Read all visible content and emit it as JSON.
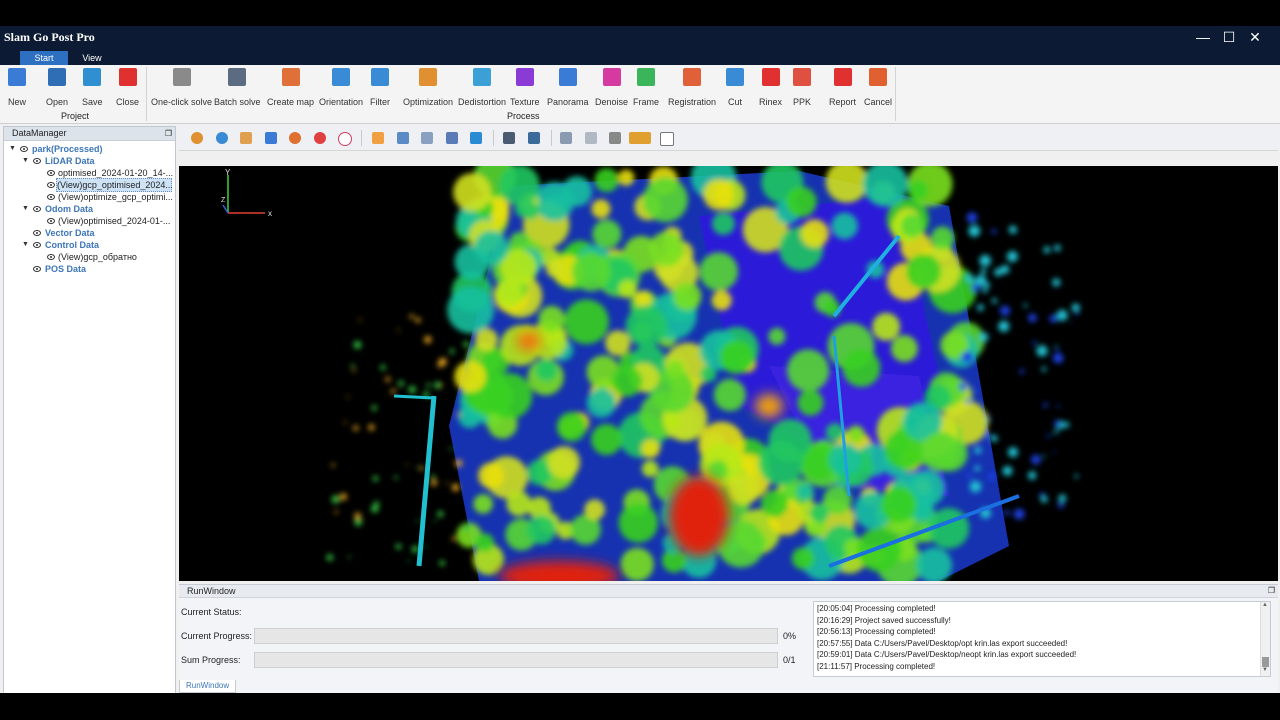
{
  "window": {
    "title": "Slam Go Post Pro",
    "minimize_glyph": "—",
    "maximize_glyph": "☐",
    "close_glyph": "✕"
  },
  "ribbon_tabs": [
    {
      "label": "Start",
      "active": true
    },
    {
      "label": "View",
      "active": false
    }
  ],
  "ribbon": {
    "groups": [
      {
        "label": "Project"
      },
      {
        "label": "Process"
      }
    ],
    "project_buttons": [
      {
        "label": "New",
        "icon": "new-file-icon",
        "color": "#3a7bd5"
      },
      {
        "label": "Open",
        "icon": "open-folder-icon",
        "color": "#2f6db5"
      },
      {
        "label": "Save",
        "icon": "save-disk-icon",
        "color": "#2f8fd0"
      },
      {
        "label": "Close",
        "icon": "close-icon",
        "color": "#e03030"
      }
    ],
    "process_buttons": [
      {
        "label": "One-click solve",
        "icon": "one-click-solve-icon",
        "color": "#8a8a8a"
      },
      {
        "label": "Batch solve",
        "icon": "batch-solve-icon",
        "color": "#5a6b82"
      },
      {
        "label": "Create map",
        "icon": "create-map-icon",
        "color": "#e0703a"
      },
      {
        "label": "Orientation",
        "icon": "orientation-icon",
        "color": "#3a8bd5"
      },
      {
        "label": "Filter",
        "icon": "filter-icon",
        "color": "#3a8bd5"
      },
      {
        "label": "Optimization",
        "icon": "optimization-icon",
        "color": "#e09030"
      },
      {
        "label": "Dedistortion",
        "icon": "dedistortion-icon",
        "color": "#3aa0d5"
      },
      {
        "label": "Texture",
        "icon": "texture-icon",
        "color": "#8a3ad5"
      },
      {
        "label": "Panorama",
        "icon": "panorama-icon",
        "color": "#3a7bd5"
      },
      {
        "label": "Denoise",
        "icon": "denoise-icon",
        "color": "#d53aa0"
      },
      {
        "label": "Frame",
        "icon": "frame-icon",
        "color": "#3ab55a"
      },
      {
        "label": "Registration",
        "icon": "registration-icon",
        "color": "#e0603a"
      },
      {
        "label": "Cut",
        "icon": "cut-icon",
        "color": "#3a8bd5"
      },
      {
        "label": "Rinex",
        "icon": "rinex-icon",
        "color": "#e03030"
      },
      {
        "label": "PPK",
        "icon": "ppk-icon",
        "color": "#e05040"
      },
      {
        "label": "Report",
        "icon": "report-pdf-icon",
        "color": "#e03030"
      },
      {
        "label": "Cancel",
        "icon": "cancel-icon",
        "color": "#e06030"
      }
    ]
  },
  "data_manager": {
    "title": "DataManager",
    "root": "park(Processed)",
    "lidar": {
      "label": "LiDAR Data",
      "items": [
        "optimised_2024-01-20_14-...",
        "(View)gcp_optimised_2024..."
      ],
      "selected_index": 1
    },
    "lidar_extra": "(View)optimize_gcp_optimi...",
    "odom": {
      "label": "Odom Data",
      "items": [
        "(View)optimised_2024-01-..."
      ]
    },
    "vector": {
      "label": "Vector Data"
    },
    "control": {
      "label": "Control Data",
      "items": [
        "(View)gcp_обратно"
      ]
    },
    "pos": {
      "label": "POS Data"
    }
  },
  "viewport": {
    "axis_x": "x",
    "axis_y": "Y",
    "axis_z": "Z"
  },
  "run_window": {
    "title": "RunWindow",
    "current_status_label": "Current Status:",
    "current_status_value": "",
    "current_progress_label": "Current Progress:",
    "current_progress": 0,
    "current_progress_text": "0%",
    "sum_progress_label": "Sum Progress:",
    "sum_progress_text": "0/1",
    "log": [
      "[20:05:04] Processing completed!",
      "[20:16:29] Project saved successfully!",
      "[20:56:13] Processing completed!",
      "[20:57:55] Data C:/Users/Pavel/Desktop/opt krin.las  export succeeded!",
      "[20:59:01] Data C:/Users/Pavel/Desktop/neopt krin.las  export succeeded!",
      "[21:11:57] Processing completed!"
    ],
    "tab_label": "RunWindow"
  },
  "colors": {
    "accent": "#2d6fc0",
    "titlebar": "#0c1b33",
    "tree_link": "#3c76b8"
  }
}
